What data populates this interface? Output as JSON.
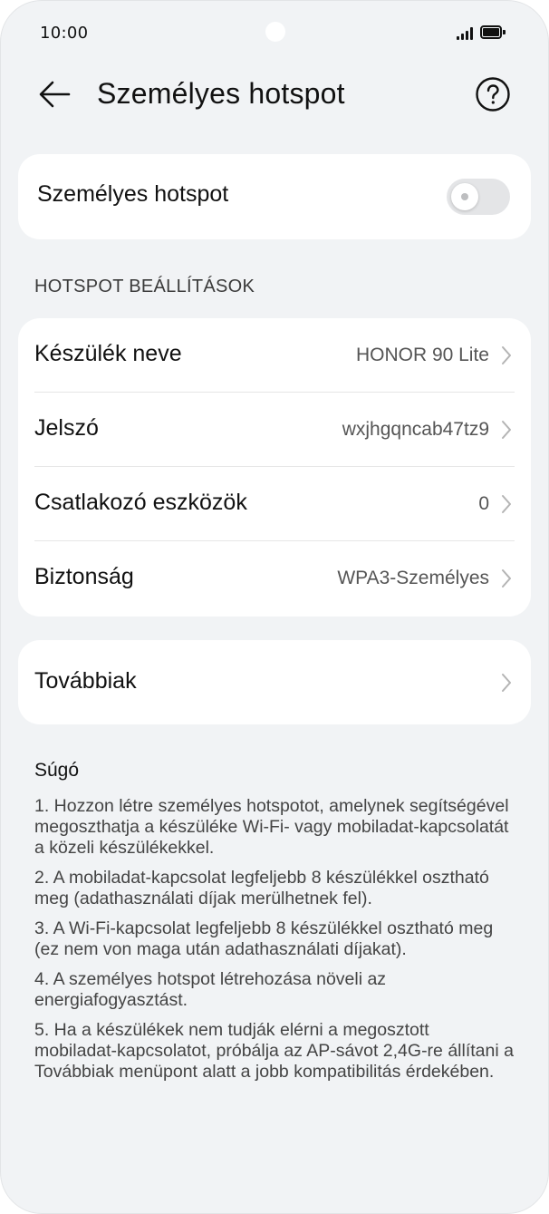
{
  "status_bar": {
    "time": "10:00"
  },
  "header": {
    "title": "Személyes hotspot"
  },
  "hotspot_toggle": {
    "label": "Személyes hotspot",
    "state": "off"
  },
  "settings": {
    "section_title": "HOTSPOT BEÁLLÍTÁSOK",
    "rows": [
      {
        "label": "Készülék neve",
        "value": "HONOR 90 Lite"
      },
      {
        "label": "Jelszó",
        "value": "wxjhgqncab47tz9"
      },
      {
        "label": "Csatlakozó eszközök",
        "value": "0"
      },
      {
        "label": "Biztonság",
        "value": "WPA3-Személyes"
      }
    ]
  },
  "more": {
    "label": "Továbbiak"
  },
  "help": {
    "title": "Súgó",
    "items": [
      "1. Hozzon létre személyes hotspotot, amelynek segítségével megoszthatja a készüléke Wi-Fi- vagy mobiladat-kapcsolatát a közeli készülékekkel.",
      "2. A mobiladat-kapcsolat legfeljebb 8 készülékkel osztható meg (adathasználati díjak merülhetnek fel).",
      "3. A Wi-Fi-kapcsolat legfeljebb 8 készülékkel osztható meg (ez nem von maga után adathasználati díjakat).",
      "4. A személyes hotspot létrehozása növeli az energiafogyasztást.",
      "5. Ha a készülékek nem tudják elérni a megosztott mobiladat-kapcsolatot, próbálja az AP-sávot 2,4G-re állítani a Továbbiak menüpont alatt a jobb kompatibilitás érdekében."
    ]
  },
  "colors": {
    "background": "#f1f3f5",
    "card": "#ffffff",
    "switch_off": "#e4e5e7",
    "text_primary": "#111111",
    "text_secondary": "#555555"
  }
}
